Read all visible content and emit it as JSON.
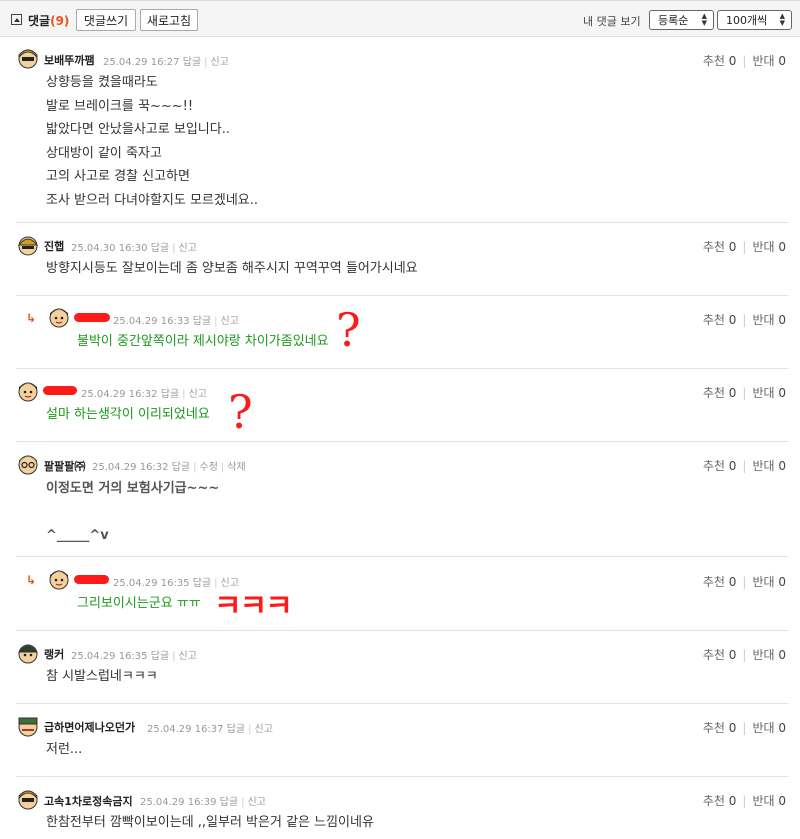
{
  "header": {
    "title": "댓글",
    "count": "(9)",
    "write_button": "댓글쓰기",
    "refresh_button": "새로고침",
    "my_comments": "내 댓글 보기",
    "sort_select": "등록순",
    "per_page_select": "100개씩"
  },
  "comments": [
    {
      "nick": "보배뚜까팸",
      "date": "25.04.29 16:27",
      "actions": [
        "답글",
        "신고"
      ],
      "body": "상향등을 켰을때라도\n발로 브레이크를 꾹~~~!!\n밟았다면 안났을사고로 보입니다..\n상대방이 같이 죽자고\n고의 사고로 경찰 신고하면\n조사 받으러 다녀야할지도 모르겠네요..",
      "up_label": "추천",
      "up": "0",
      "down_label": "반대",
      "down": "0"
    },
    {
      "nick": "진햅",
      "date": "25.04.30 16:30",
      "actions": [
        "답글",
        "신고"
      ],
      "body": "방향지시등도 잘보이는데 좀 양보좀 해주시지 꾸역꾸역 들어가시네요",
      "up_label": "추천",
      "up": "0",
      "down_label": "반대",
      "down": "0"
    },
    {
      "nick": "",
      "date": "25.04.29 16:33",
      "actions": [
        "답글",
        "신고"
      ],
      "body": "불박이 중간앞쪽이라 제시야랑 차이가좀있네요",
      "up_label": "추천",
      "up": "0",
      "down_label": "반대",
      "down": "0"
    },
    {
      "nick": "",
      "date": "25.04.29 16:32",
      "actions": [
        "답글",
        "신고"
      ],
      "body": "설마 하는생각이 이리되었네요",
      "up_label": "추천",
      "up": "0",
      "down_label": "반대",
      "down": "0"
    },
    {
      "nick": "팔팔팔㈜",
      "date": "25.04.29 16:32",
      "actions": [
        "답글",
        "수정",
        "삭제"
      ],
      "body": "이정도면 거의 보험사기급~~~\n\n^_____^v",
      "up_label": "추천",
      "up": "0",
      "down_label": "반대",
      "down": "0"
    },
    {
      "nick": "",
      "date": "25.04.29 16:35",
      "actions": [
        "답글",
        "신고"
      ],
      "body": "그리보이시는군요 ㅠㅠ",
      "up_label": "추천",
      "up": "0",
      "down_label": "반대",
      "down": "0"
    },
    {
      "nick": "랭커",
      "date": "25.04.29 16:35",
      "actions": [
        "답글",
        "신고"
      ],
      "body": "참 시발스럽네ㅋㅋㅋ",
      "up_label": "추천",
      "up": "0",
      "down_label": "반대",
      "down": "0"
    },
    {
      "nick": "급하면어제나오던가",
      "date": "25.04.29 16:37",
      "actions": [
        "답글",
        "신고"
      ],
      "body": "저런...",
      "up_label": "추천",
      "up": "0",
      "down_label": "반대",
      "down": "0"
    },
    {
      "nick": "고속1차로정속금지",
      "date": "25.04.29 16:39",
      "actions": [
        "답글",
        "신고"
      ],
      "body": "한참전부터 깜빡이보이는데 ,,일부러 박은거 같은 느낌이네유",
      "up_label": "추천",
      "up": "0",
      "down_label": "반대",
      "down": "0"
    }
  ],
  "annotations": {
    "question_mark": "?",
    "kkk": "ㅋㅋㅋ"
  },
  "colors": {
    "accent": "#e8541c",
    "reply_text": "#1a9a1a",
    "redaction": "#ff1a1a",
    "annotation": "#ff1a1a"
  }
}
